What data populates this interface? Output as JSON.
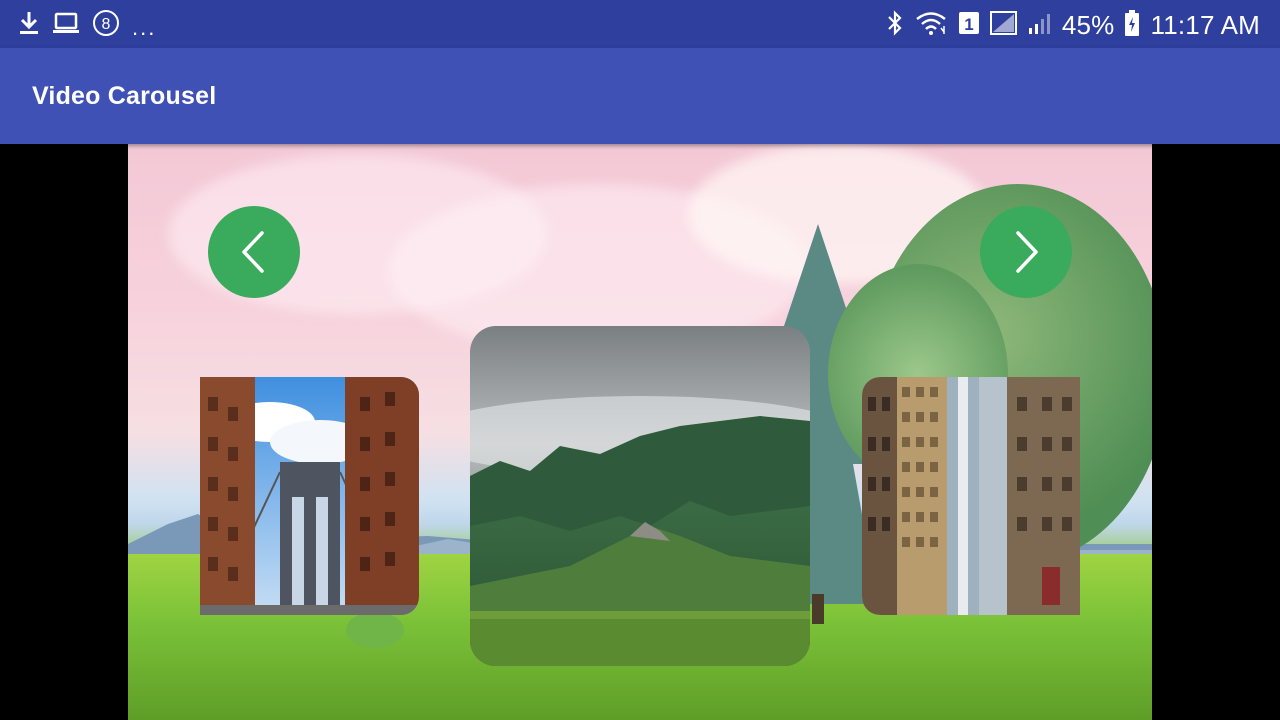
{
  "status_bar": {
    "left_icons": [
      "download-icon",
      "laptop-icon",
      "notification-badge-icon"
    ],
    "badge_number": "8",
    "overflow": "...",
    "right_icons": [
      "bluetooth-icon",
      "wifi-icon",
      "sim-icon",
      "signal-icon",
      "signal-icon",
      "battery-icon"
    ],
    "sim_number": "1",
    "battery": "45%",
    "time": "11:17 AM"
  },
  "app_bar": {
    "title": "Video Carousel"
  },
  "carousel": {
    "prev_icon": "chevron-left-icon",
    "next_icon": "chevron-right-icon",
    "items": [
      {
        "id": "thumb-bridge",
        "icon": "bridge-city-image"
      },
      {
        "id": "thumb-forest",
        "icon": "misty-forest-image"
      },
      {
        "id": "thumb-buildings",
        "icon": "city-buildings-image"
      }
    ]
  },
  "colors": {
    "status_bar": "#2f3f9e",
    "app_bar": "#3f51b5",
    "nav_button": "#3aaa5c"
  }
}
